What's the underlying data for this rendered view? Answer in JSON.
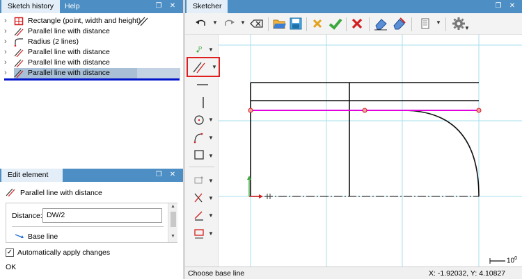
{
  "history_panel": {
    "tabs": [
      {
        "label": "Sketch history"
      },
      {
        "label": "Help"
      }
    ],
    "items": [
      {
        "label": "Rectangle (point, width and height)"
      },
      {
        "label": "Parallel line with distance"
      },
      {
        "label": "Radius (2 lines)"
      },
      {
        "label": "Parallel line with distance"
      },
      {
        "label": "Parallel line with distance"
      },
      {
        "label": "Parallel line with distance"
      }
    ]
  },
  "edit_panel": {
    "tab": "Edit element",
    "element_title": "Parallel line with distance",
    "distance_label": "Distance:",
    "distance_value": "DW/2",
    "base_line_label": "Base line",
    "auto_apply_label": "Automatically apply changes",
    "auto_apply_checked": true,
    "status": "OK"
  },
  "sketcher": {
    "tab": "Sketcher",
    "status_left": "Choose base line",
    "coordinates": "X: -1.92032, Y: 4.10827",
    "scale_label": "10",
    "scale_exp": "0"
  },
  "icons": {
    "undo": "undo-icon",
    "redo": "redo-icon",
    "clear": "clear-icon",
    "open": "folder-open-icon",
    "save": "save-icon",
    "cancel": "cancel-icon",
    "accept": "checkmark-icon",
    "close": "close-icon",
    "eraser": "eraser-icon",
    "settings": "gear-icon"
  },
  "colors": {
    "tab_bar": "#4d8fc4",
    "active_tab": "#e3eef8",
    "selection_row": "#a8bfd6",
    "selection_underline": "#0014c8",
    "grid": "#a5dfec",
    "highlight_line": "#e000e0",
    "active_tool_border": "#e02020"
  }
}
